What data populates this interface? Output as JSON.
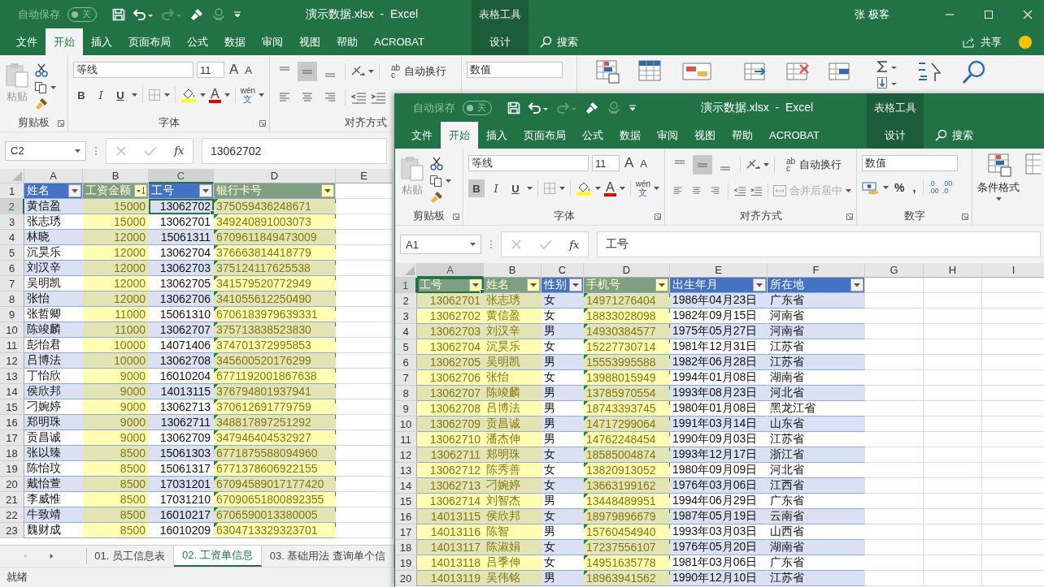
{
  "windows": [
    {
      "autosave": "自动保存",
      "autosave_state": "关",
      "title": "演示数据.xlsx  -  Excel",
      "context_group": "表格工具",
      "user": "张 极客",
      "tabs": [
        {
          "label": "文件",
          "selected": false
        },
        {
          "label": "开始",
          "selected": true
        },
        {
          "label": "插入",
          "selected": false
        },
        {
          "label": "页面布局",
          "selected": false
        },
        {
          "label": "公式",
          "selected": false
        },
        {
          "label": "数据",
          "selected": false
        },
        {
          "label": "审阅",
          "selected": false
        },
        {
          "label": "视图",
          "selected": false
        },
        {
          "label": "帮助",
          "selected": false
        },
        {
          "label": "ACROBAT",
          "selected": false
        }
      ],
      "context_tab": {
        "label": "设计",
        "selected": false
      },
      "search": "搜索",
      "share": "共享",
      "ribbon": {
        "paste": "粘贴",
        "clipboard_label": "剪贴板",
        "font_name": "等线",
        "font_size": "11",
        "grow_font": "A",
        "shrink_font": "A",
        "font_styles": [
          {
            "label": "B",
            "on": false
          },
          {
            "label": "I",
            "on": false
          },
          {
            "label": "U",
            "on": false
          }
        ],
        "font_color": "A",
        "phonetic_top": "wén",
        "phonetic_bottom": "文",
        "font_label": "字体",
        "vertical_align": [
          {
            "on": false
          },
          {
            "on": true
          },
          {
            "on": false
          }
        ],
        "wrap_icon_top": "ab",
        "wrap_icon_bottom": "c",
        "wrap_text": "自动换行",
        "align_label": "对齐方式",
        "number_format": "数值"
      },
      "name_box": "C2",
      "cancel_enabled": false,
      "fx": "fx",
      "formula": "13062702",
      "sheet": {
        "columns": [
          {
            "letter": "A",
            "selected": false,
            "highlighted": false,
            "flagged": false,
            "kind": "text"
          },
          {
            "letter": "B",
            "selected": false,
            "highlighted": true,
            "flagged": false,
            "kind": "number"
          },
          {
            "letter": "C",
            "selected": true,
            "highlighted": false,
            "flagged": false,
            "kind": "number"
          },
          {
            "letter": "D",
            "selected": false,
            "highlighted": true,
            "flagged": true,
            "kind": "text"
          },
          {
            "letter": "E",
            "selected": false
          }
        ],
        "header_row": {
          "number": "1",
          "selected": false
        },
        "table_headers": [
          {
            "label": "姓名",
            "sorted": false
          },
          {
            "label": "工资金额",
            "sorted": true
          },
          {
            "label": "工号",
            "sorted": false
          },
          {
            "label": "银行卡号",
            "sorted": false
          }
        ],
        "rows": [
          {
            "number": "2",
            "selected": true,
            "cells": [
              "黄信盈",
              "15000",
              "13062702",
              "375059436248671"
            ]
          },
          {
            "number": "3",
            "selected": false,
            "cells": [
              "张志琇",
              "15000",
              "13062701",
              "349240891003073"
            ]
          },
          {
            "number": "4",
            "selected": false,
            "cells": [
              "林晓",
              "12000",
              "15061311",
              "6709611849473009"
            ]
          },
          {
            "number": "5",
            "selected": false,
            "cells": [
              "沉昊乐",
              "12000",
              "13062704",
              "376663814418779"
            ]
          },
          {
            "number": "6",
            "selected": false,
            "cells": [
              "刘汉辛",
              "12000",
              "13062703",
              "375124117625538"
            ]
          },
          {
            "number": "7",
            "selected": false,
            "cells": [
              "吴明凯",
              "12000",
              "13062705",
              "341579520772949"
            ]
          },
          {
            "number": "8",
            "selected": false,
            "cells": [
              "张怡",
              "12000",
              "13062706",
              "341055612250490"
            ]
          },
          {
            "number": "9",
            "selected": false,
            "cells": [
              "张哲卿",
              "11000",
              "15061310",
              "6706183979639331"
            ]
          },
          {
            "number": "10",
            "selected": false,
            "cells": [
              "陈竣麟",
              "11000",
              "13062707",
              "375713838523830"
            ]
          },
          {
            "number": "11",
            "selected": false,
            "cells": [
              "彭怡君",
              "10000",
              "14071406",
              "374701372995853"
            ]
          },
          {
            "number": "12",
            "selected": false,
            "cells": [
              "吕博法",
              "10000",
              "13062708",
              "345600520176299"
            ]
          },
          {
            "number": "13",
            "selected": false,
            "cells": [
              "丁怡欣",
              "9000",
              "16010204",
              "6771192001867638"
            ]
          },
          {
            "number": "14",
            "selected": false,
            "cells": [
              "侯欣邦",
              "9000",
              "14013115",
              "376794801937941"
            ]
          },
          {
            "number": "15",
            "selected": false,
            "cells": [
              "刁婉婷",
              "9000",
              "13062713",
              "370612691779759"
            ]
          },
          {
            "number": "16",
            "selected": false,
            "cells": [
              "郑明珠",
              "9000",
              "13062711",
              "348817897251292"
            ]
          },
          {
            "number": "17",
            "selected": false,
            "cells": [
              "贡昌诚",
              "9000",
              "13062709",
              "347946404532927"
            ]
          },
          {
            "number": "18",
            "selected": false,
            "cells": [
              "张以臻",
              "8500",
              "15061303",
              "6771875588094960"
            ]
          },
          {
            "number": "19",
            "selected": false,
            "cells": [
              "陈怡玟",
              "8500",
              "15061317",
              "6771378606922155"
            ]
          },
          {
            "number": "20",
            "selected": false,
            "cells": [
              "戴怡萱",
              "8500",
              "17031201",
              "67094589017177420"
            ]
          },
          {
            "number": "21",
            "selected": false,
            "cells": [
              "李威惟",
              "8500",
              "17031210",
              "67090651800892355"
            ]
          },
          {
            "number": "22",
            "selected": false,
            "cells": [
              "牛致靖",
              "8500",
              "16010217",
              "6706590013380005"
            ]
          },
          {
            "number": "23",
            "selected": false,
            "cells": [
              "魏财成",
              "8500",
              "16010209",
              "6304713329323701"
            ]
          }
        ]
      },
      "sheet_tabs": [
        {
          "label": "01. 员工信息表",
          "selected": false
        },
        {
          "label": "02. 工资单信息",
          "selected": true
        },
        {
          "label": "03. 基础用法 查询单个信",
          "selected": false
        }
      ],
      "status": "就绪"
    },
    {
      "autosave": "自动保存",
      "autosave_state": "关",
      "title": "演示数据.xlsx  -  Excel",
      "context_group": "表格工具",
      "tabs": [
        {
          "label": "文件",
          "selected": false
        },
        {
          "label": "开始",
          "selected": true
        },
        {
          "label": "插入",
          "selected": false
        },
        {
          "label": "页面布局",
          "selected": false
        },
        {
          "label": "公式",
          "selected": false
        },
        {
          "label": "数据",
          "selected": false
        },
        {
          "label": "审阅",
          "selected": false
        },
        {
          "label": "视图",
          "selected": false
        },
        {
          "label": "帮助",
          "selected": false
        },
        {
          "label": "ACROBAT",
          "selected": false
        }
      ],
      "context_tab": {
        "label": "设计",
        "selected": false
      },
      "search": "搜索",
      "ribbon": {
        "paste": "粘贴",
        "clipboard_label": "剪贴板",
        "font_name": "等线",
        "font_size": "11",
        "grow_font": "A",
        "shrink_font": "A",
        "font_styles": [
          {
            "label": "B",
            "on": true
          },
          {
            "label": "I",
            "on": false
          },
          {
            "label": "U",
            "on": false
          }
        ],
        "font_color": "A",
        "phonetic_top": "wén",
        "phonetic_bottom": "文",
        "font_label": "字体",
        "vertical_align": [
          {
            "on": false
          },
          {
            "on": true
          },
          {
            "on": false
          }
        ],
        "wrap_icon_top": "ab",
        "wrap_icon_bottom": "c",
        "wrap_text": "自动换行",
        "merge": {
          "label": "合并后居中",
          "disabled": true
        },
        "align_label": "对齐方式",
        "number_format": "数值",
        "percent": "%",
        "comma": ",",
        "decimals": [
          {
            "top": ".0",
            "bottom": ".00"
          },
          {
            "top": ".00",
            "bottom": ".0"
          }
        ],
        "number_label": "数字",
        "conditional_format": "条件格式"
      },
      "name_box": "A1",
      "cancel_enabled": false,
      "fx": "fx",
      "formula": "工号",
      "sheet": {
        "columns": [
          {
            "letter": "A",
            "selected": true,
            "highlighted": true,
            "flagged": false,
            "kind": "number"
          },
          {
            "letter": "B",
            "selected": false,
            "highlighted": true,
            "flagged": false,
            "kind": "text"
          },
          {
            "letter": "C",
            "selected": false,
            "highlighted": false,
            "flagged": false,
            "kind": "text"
          },
          {
            "letter": "D",
            "selected": false,
            "highlighted": true,
            "flagged": true,
            "kind": "text"
          },
          {
            "letter": "E",
            "selected": false,
            "highlighted": false,
            "flagged": false,
            "kind": "text"
          },
          {
            "letter": "F",
            "selected": false,
            "highlighted": false,
            "flagged": false,
            "kind": "text"
          },
          {
            "letter": "G",
            "selected": false
          },
          {
            "letter": "H",
            "selected": false
          },
          {
            "letter": "I",
            "selected": false
          }
        ],
        "header_row": {
          "number": "1",
          "selected": true
        },
        "table_headers": [
          {
            "label": "工号",
            "sorted": false
          },
          {
            "label": "姓名",
            "sorted": false
          },
          {
            "label": "性别",
            "sorted": false
          },
          {
            "label": "手机号",
            "sorted": false
          },
          {
            "label": "出生年月",
            "sorted": false
          },
          {
            "label": "所在地",
            "sorted": false
          }
        ],
        "rows": [
          {
            "number": "2",
            "selected": false,
            "cells": [
              "13062701",
              "张志琇",
              "女",
              "14971276404",
              "1986年04月23日",
              "广东省"
            ]
          },
          {
            "number": "3",
            "selected": false,
            "cells": [
              "13062702",
              "黄信盈",
              "女",
              "18833028098",
              "1982年09月15日",
              "河南省"
            ]
          },
          {
            "number": "4",
            "selected": false,
            "cells": [
              "13062703",
              "刘汉辛",
              "男",
              "14930384577",
              "1975年05月27日",
              "河南省"
            ]
          },
          {
            "number": "5",
            "selected": false,
            "cells": [
              "13062704",
              "沉昊乐",
              "女",
              "15227730714",
              "1981年12月31日",
              "江苏省"
            ]
          },
          {
            "number": "6",
            "selected": false,
            "cells": [
              "13062705",
              "吴明凯",
              "男",
              "15553995588",
              "1982年06月28日",
              "江苏省"
            ]
          },
          {
            "number": "7",
            "selected": false,
            "cells": [
              "13062706",
              "张怡",
              "女",
              "13988015949",
              "1994年01月08日",
              "湖南省"
            ]
          },
          {
            "number": "8",
            "selected": false,
            "cells": [
              "13062707",
              "陈竣麟",
              "男",
              "13785970554",
              "1993年08月23日",
              "河北省"
            ]
          },
          {
            "number": "9",
            "selected": false,
            "cells": [
              "13062708",
              "吕博法",
              "男",
              "18743393745",
              "1980年01月08日",
              "黑龙江省"
            ]
          },
          {
            "number": "10",
            "selected": false,
            "cells": [
              "13062709",
              "贡昌诚",
              "男",
              "14717299064",
              "1991年03月14日",
              "山东省"
            ]
          },
          {
            "number": "11",
            "selected": false,
            "cells": [
              "13062710",
              "潘杰伸",
              "男",
              "14762248454",
              "1990年09月03日",
              "江苏省"
            ]
          },
          {
            "number": "12",
            "selected": false,
            "cells": [
              "13062711",
              "郑明珠",
              "女",
              "18585004874",
              "1993年12月17日",
              "浙江省"
            ]
          },
          {
            "number": "13",
            "selected": false,
            "cells": [
              "13062712",
              "陈秀善",
              "女",
              "13820913052",
              "1980年09月09日",
              "河北省"
            ]
          },
          {
            "number": "14",
            "selected": false,
            "cells": [
              "13062713",
              "刁婉婷",
              "女",
              "13663199162",
              "1976年03月06日",
              "江西省"
            ]
          },
          {
            "number": "15",
            "selected": false,
            "cells": [
              "13062714",
              "刘智杰",
              "男",
              "13448489951",
              "1994年06月29日",
              "广东省"
            ]
          },
          {
            "number": "16",
            "selected": false,
            "cells": [
              "14013115",
              "侯欣邦",
              "女",
              "18979896679",
              "1987年05月19日",
              "云南省"
            ]
          },
          {
            "number": "17",
            "selected": false,
            "cells": [
              "14013116",
              "陈智",
              "男",
              "15760454940",
              "1993年03月03日",
              "山西省"
            ]
          },
          {
            "number": "18",
            "selected": false,
            "cells": [
              "14013117",
              "陈淑娟",
              "女",
              "17237556107",
              "1976年05月20日",
              "湖南省"
            ]
          },
          {
            "number": "19",
            "selected": false,
            "cells": [
              "14013118",
              "吕季伸",
              "女",
              "14951635778",
              "1981年03月06日",
              "广东省"
            ]
          },
          {
            "number": "20",
            "selected": false,
            "cells": [
              "14013119",
              "吴伟铭",
              "男",
              "18963941562",
              "1990年12月10日",
              "江苏省"
            ]
          }
        ]
      }
    }
  ]
}
